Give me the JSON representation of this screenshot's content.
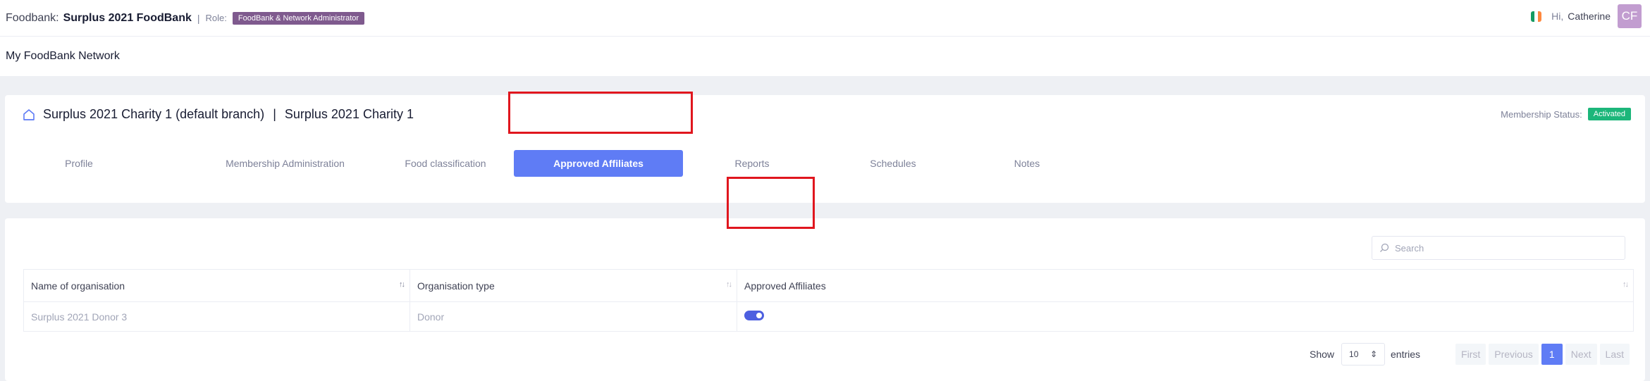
{
  "topbar": {
    "foodbank_label": "Foodbank:",
    "foodbank_name": "Surplus 2021 FoodBank",
    "separator": "|",
    "role_label": "Role:",
    "role_badge": "FoodBank & Network Administrator",
    "greeting": "Hi,",
    "user_name": "Catherine",
    "avatar_initials": "CF",
    "flag_colors": [
      "#169b62",
      "#ffffff",
      "#ff883e"
    ]
  },
  "subheader": {
    "title": "My FoodBank Network"
  },
  "branch": {
    "icon": "home-icon",
    "name": "Surplus 2021 Charity 1 (default branch)",
    "separator": "|",
    "charity": "Surplus 2021 Charity 1",
    "membership_label": "Membership Status:",
    "membership_status": "Activated"
  },
  "tabs": [
    {
      "label": "Profile"
    },
    {
      "label": "Membership Administration"
    },
    {
      "label": "Food classification"
    },
    {
      "label": "Approved Affiliates",
      "active": true
    },
    {
      "label": "Reports"
    },
    {
      "label": "Schedules"
    },
    {
      "label": "Notes"
    }
  ],
  "search": {
    "placeholder": "Search"
  },
  "table": {
    "headers": [
      "Name of organisation",
      "Organisation type",
      "Approved Affiliates"
    ],
    "rows": [
      {
        "name": "Surplus 2021 Donor 3",
        "type": "Donor",
        "approved": true
      }
    ]
  },
  "pagination": {
    "show_label": "Show",
    "page_size": "10",
    "entries_label": "entries",
    "first": "First",
    "previous": "Previous",
    "current_page": "1",
    "next": "Next",
    "last": "Last"
  },
  "colors": {
    "accent": "#5f7cf5",
    "highlight": "#e0161e",
    "role_badge": "#7f5a8e",
    "status_badge": "#1cb67a"
  }
}
